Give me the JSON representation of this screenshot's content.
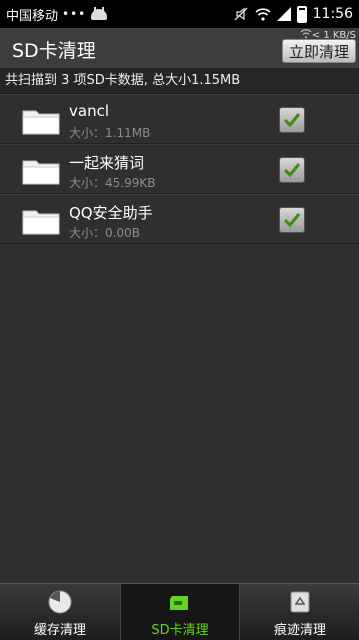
{
  "status_bar": {
    "carrier": "中国移动",
    "dots": "•••",
    "time": "11:56",
    "net_speed": "< 1 KB/S"
  },
  "header": {
    "title": "SD卡清理",
    "clean_now_label": "立即清理"
  },
  "summary": "共扫描到 3 项SD卡数据, 总大小1.15MB",
  "items": [
    {
      "name": "vancl",
      "size": "大小：1.11MB",
      "checked": true
    },
    {
      "name": "一起来猜词",
      "size": "大小：45.99KB",
      "checked": true
    },
    {
      "name": "QQ安全助手",
      "size": "大小：0.00B",
      "checked": true
    }
  ],
  "tabs": [
    {
      "label": "缓存清理",
      "icon": "clock-icon",
      "active": false
    },
    {
      "label": "SD卡清理",
      "icon": "sd-card-icon",
      "active": true
    },
    {
      "label": "痕迹清理",
      "icon": "recycle-bin-icon",
      "active": false
    }
  ],
  "colors": {
    "accent_green": "#66d11e",
    "background": "#2f2f2f"
  }
}
